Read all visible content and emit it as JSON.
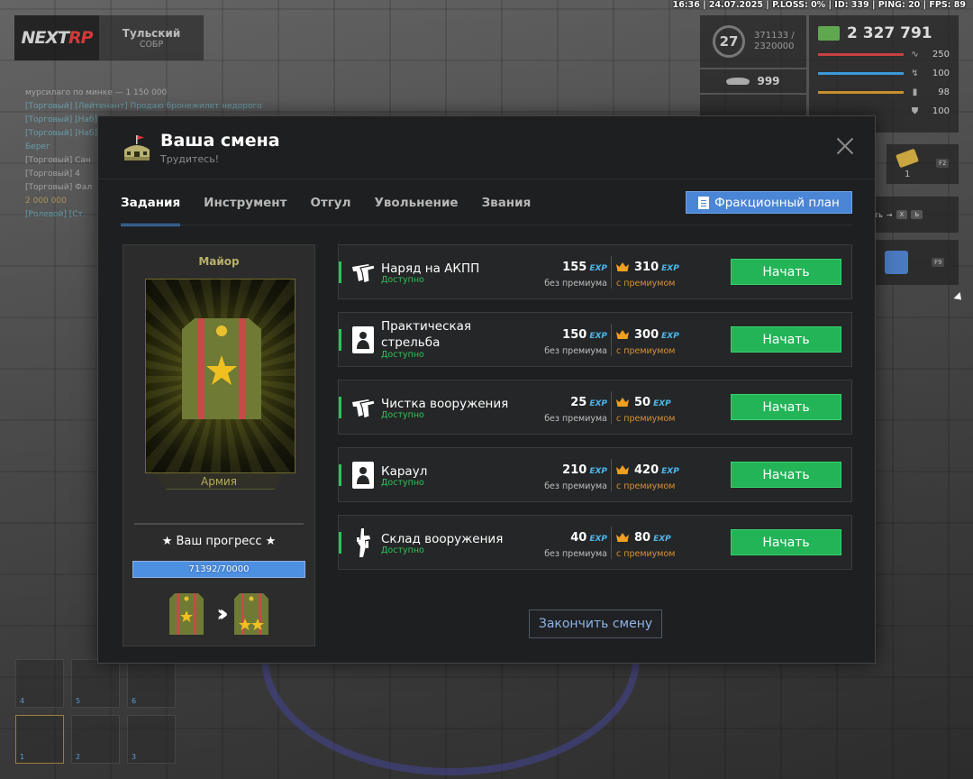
{
  "status_line": "16:36 | 24.07.2025 | P.LOSS: 0% | ID: 339 | PING: 20 | FPS: 89",
  "logo": {
    "part1": "NEXT",
    "part2": "RP"
  },
  "org": {
    "name": "Тульский",
    "faction": "СОБР"
  },
  "chat": [
    {
      "text": "мурсилаго по минке — 1 150 000",
      "color": "white"
    },
    {
      "text": "[Торговый] [Лейтенант] Продаю бронежилет недорого",
      "color": "cyan"
    },
    {
      "text": "[Торговый] [Наб]",
      "color": "cyan"
    },
    {
      "text": "[Торговый] [Наб]",
      "color": "cyan"
    },
    {
      "text": "Берег",
      "color": "cyan"
    },
    {
      "text": "[Торговый] Сан",
      "color": "white"
    },
    {
      "text": "[Торговый] 4",
      "color": "white"
    },
    {
      "text": "[Торговый] Фал",
      "color": "white"
    },
    {
      "text": "2 000 000",
      "color": "yellow"
    },
    {
      "text": "[Ролевой] [Ст.",
      "color": "cyan"
    }
  ],
  "hud": {
    "level": "27",
    "xp_current": "371133 /",
    "xp_total": "2320000",
    "likes": "999",
    "money": "2 327 791",
    "stats": [
      {
        "icon": "heart-rate-icon",
        "value": "250",
        "color": "#c94040"
      },
      {
        "icon": "running-icon",
        "value": "100",
        "color": "#3a9ad8"
      },
      {
        "icon": "food-icon",
        "value": "98",
        "color": "#c8902c"
      },
      {
        "icon": "armor-icon",
        "value": "100",
        "color": "#d0d0d0"
      }
    ],
    "inventory_count": "1",
    "inventory_key": "F2",
    "calendar_key": "F9",
    "keys_hint": "нить",
    "keys": [
      "X",
      "Ь"
    ]
  },
  "weapon_slots": [
    {
      "num": "4"
    },
    {
      "num": "5"
    },
    {
      "num": "6"
    },
    {
      "num": "1"
    },
    {
      "num": "2"
    },
    {
      "num": "3"
    }
  ],
  "modal": {
    "title": "Ваша смена",
    "subtitle": "Трудитесь!",
    "tabs": [
      {
        "label": "Задания",
        "active": true
      },
      {
        "label": "Инструмент",
        "active": false
      },
      {
        "label": "Отгул",
        "active": false
      },
      {
        "label": "Увольнение",
        "active": false
      },
      {
        "label": "Звания",
        "active": false
      }
    ],
    "plan_button": "Фракционный план",
    "rank": {
      "name": "Майор",
      "faction": "Армия",
      "progress_title": "★ Ваш прогресс ★",
      "progress_text": "71392/70000",
      "progress_fraction": 1.0
    },
    "exp_label": "EXP",
    "without_premium": "без премиума",
    "with_premium": "с премиумом",
    "start_label": "Начать",
    "tasks": [
      {
        "name": "Наряд на АКПП",
        "status": "Доступно",
        "exp": "155",
        "exp_premium": "310",
        "icon": "pistol-icon"
      },
      {
        "name": "Практическая стрельба",
        "status": "Доступно",
        "exp": "150",
        "exp_premium": "300",
        "icon": "target-icon"
      },
      {
        "name": "Чистка вооружения",
        "status": "Доступно",
        "exp": "25",
        "exp_premium": "50",
        "icon": "pistol-icon"
      },
      {
        "name": "Караул",
        "status": "Доступно",
        "exp": "210",
        "exp_premium": "420",
        "icon": "target-icon"
      },
      {
        "name": "Склад вооружения",
        "status": "Доступно",
        "exp": "40",
        "exp_premium": "80",
        "icon": "rifle-icon"
      }
    ],
    "end_shift": "Закончить смену"
  }
}
